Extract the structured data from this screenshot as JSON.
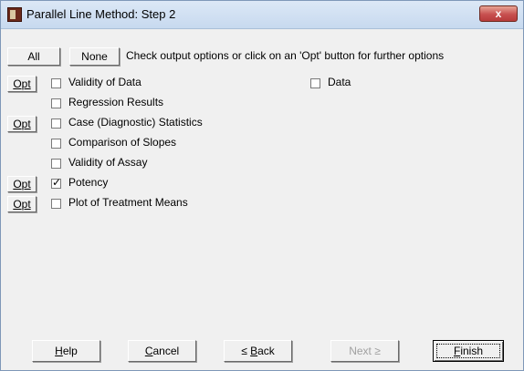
{
  "window": {
    "title": "Parallel Line Method: Step 2",
    "close_glyph": "x"
  },
  "header": {
    "all_label": "All",
    "none_label": "None",
    "hint": "Check output options or click on an 'Opt' button for further options"
  },
  "opt_label": "Opt",
  "options": [
    {
      "label": "Validity of Data",
      "checked": false,
      "has_opt": true
    },
    {
      "label": "Regression Results",
      "checked": false,
      "has_opt": false
    },
    {
      "label": "Case (Diagnostic) Statistics",
      "checked": false,
      "has_opt": true
    },
    {
      "label": "Comparison of Slopes",
      "checked": false,
      "has_opt": false
    },
    {
      "label": "Validity of Assay",
      "checked": false,
      "has_opt": false
    },
    {
      "label": "Potency",
      "checked": true,
      "has_opt": true
    },
    {
      "label": "Plot of Treatment Means",
      "checked": false,
      "has_opt": true
    }
  ],
  "extra_option": {
    "label": "Data",
    "checked": false
  },
  "footer": {
    "help": {
      "mnemonic": "H",
      "rest": "elp"
    },
    "cancel": {
      "mnemonic": "C",
      "rest": "ancel"
    },
    "back": {
      "prefix": "≤ ",
      "mnemonic": "B",
      "rest": "ack",
      "enabled": true
    },
    "next": {
      "label": "Next ≥",
      "enabled": false
    },
    "finish": {
      "mnemonic": "F",
      "rest": "inish"
    }
  }
}
